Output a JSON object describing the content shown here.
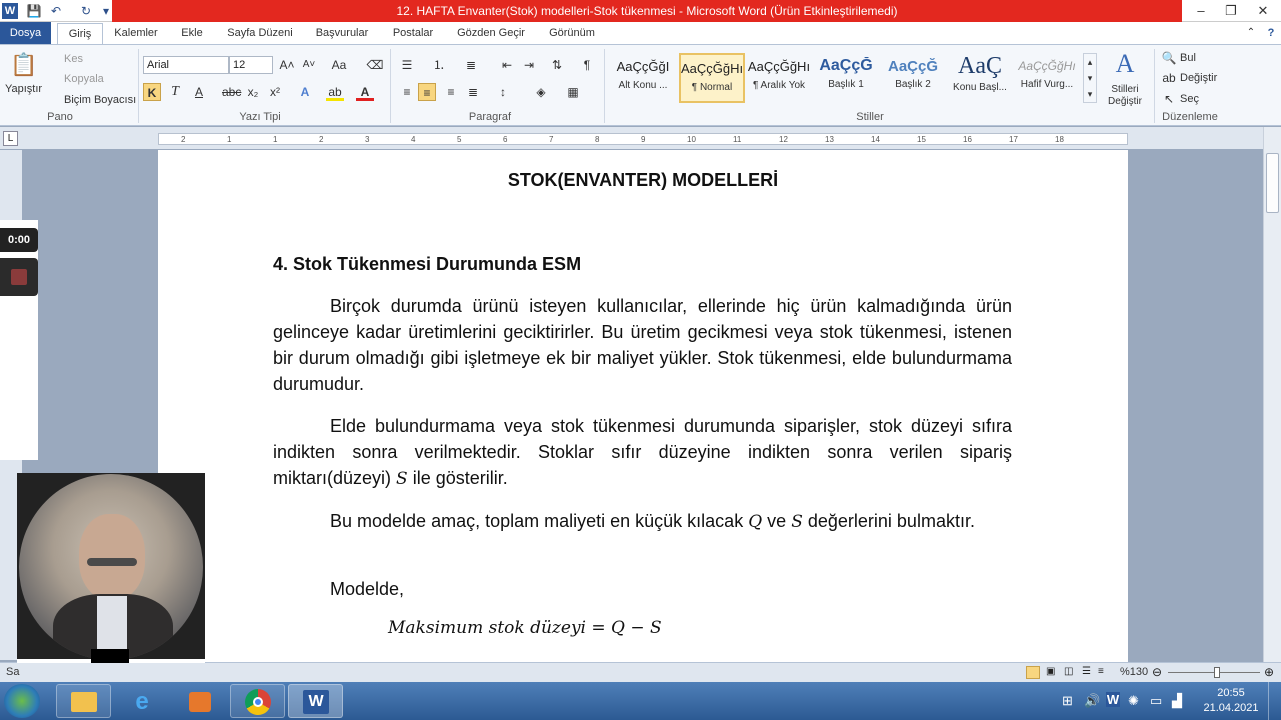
{
  "window": {
    "title": "12. HAFTA Envanter(Stok) modelleri-Stok tükenmesi  -  Microsoft Word (Ürün Etkinleştirilemedi)"
  },
  "tabs": [
    "Dosya",
    "Giriş",
    "Kalemler",
    "Ekle",
    "Sayfa Düzeni",
    "Başvurular",
    "Postalar",
    "Gözden Geçir",
    "Görünüm"
  ],
  "ribbon": {
    "clipboard": {
      "paste": "Yapıştır",
      "cut": "Kes",
      "copy": "Kopyala",
      "format_painter": "Biçim Boyacısı",
      "label": "Pano"
    },
    "font": {
      "family": "Arial",
      "size": "12",
      "label": "Yazı Tipi",
      "bold": "K",
      "italic": "T"
    },
    "paragraph": {
      "label": "Paragraf"
    },
    "styles": {
      "label": "Stiller",
      "items": [
        {
          "sample": "AaÇçĞğI",
          "name": "Alt Konu ..."
        },
        {
          "sample": "AaÇçĞğHı",
          "name": "¶ Normal"
        },
        {
          "sample": "AaÇçĞğHı",
          "name": "¶ Aralık Yok"
        },
        {
          "sample": "AaÇçĞ",
          "name": "Başlık 1"
        },
        {
          "sample": "AaÇçĞ",
          "name": "Başlık 2"
        },
        {
          "sample": "AaÇ",
          "name": "Konu Başl..."
        },
        {
          "sample": "AaÇçĞğHı",
          "name": "Hafif Vurg..."
        }
      ],
      "change_styles": "Stilleri Değiştir"
    },
    "editing": {
      "label": "Düzenleme",
      "find": "Bul",
      "replace": "Değiştir",
      "select": "Seç"
    }
  },
  "ruler_numbers": [
    "2",
    "1",
    "1",
    "2",
    "3",
    "4",
    "5",
    "6",
    "7",
    "8",
    "9",
    "10",
    "11",
    "12",
    "13",
    "14",
    "15",
    "16",
    "17",
    "18"
  ],
  "document": {
    "title": "STOK(ENVANTER) MODELLERİ",
    "heading": "4. Stok Tükenmesi Durumunda ESM",
    "p1": "Birçok durumda ürünü isteyen kullanıcılar, ellerinde hiç ürün kalmadığında ürün gelinceye kadar üretimlerini geciktirirler. Bu üretim gecikmesi veya stok tükenmesi, istenen bir durum olmadığı gibi işletmeye ek bir maliyet yükler. Stok tükenmesi, elde bulundurmama durumudur.",
    "p2_a": "Elde bulundurmama veya stok tükenmesi durumunda siparişler, stok düzeyi sıfıra indikten sonra verilmektedir. Stoklar sıfır düzeyine indikten sonra verilen sipariş miktarı(düzeyi)",
    "p2_var": "S",
    "p2_b": "ile gösterilir.",
    "p3_a": "Bu modelde amaç, toplam maliyeti en küçük kılacak",
    "p3_q": "Q",
    "p3_mid": "ve",
    "p3_s": "S",
    "p3_b": "değerlerini bulmaktır.",
    "p4": "Modelde,",
    "formula": "Maksimum stok düzeyi = Q − S"
  },
  "statusbar": {
    "left": "Sa",
    "zoom": "%130"
  },
  "recorder": {
    "time": "0:00"
  },
  "taskbar": {
    "time": "20:55",
    "date": "21.04.2021"
  },
  "colors": {
    "title_red": "#e3281f",
    "file_tab": "#2b579a"
  }
}
